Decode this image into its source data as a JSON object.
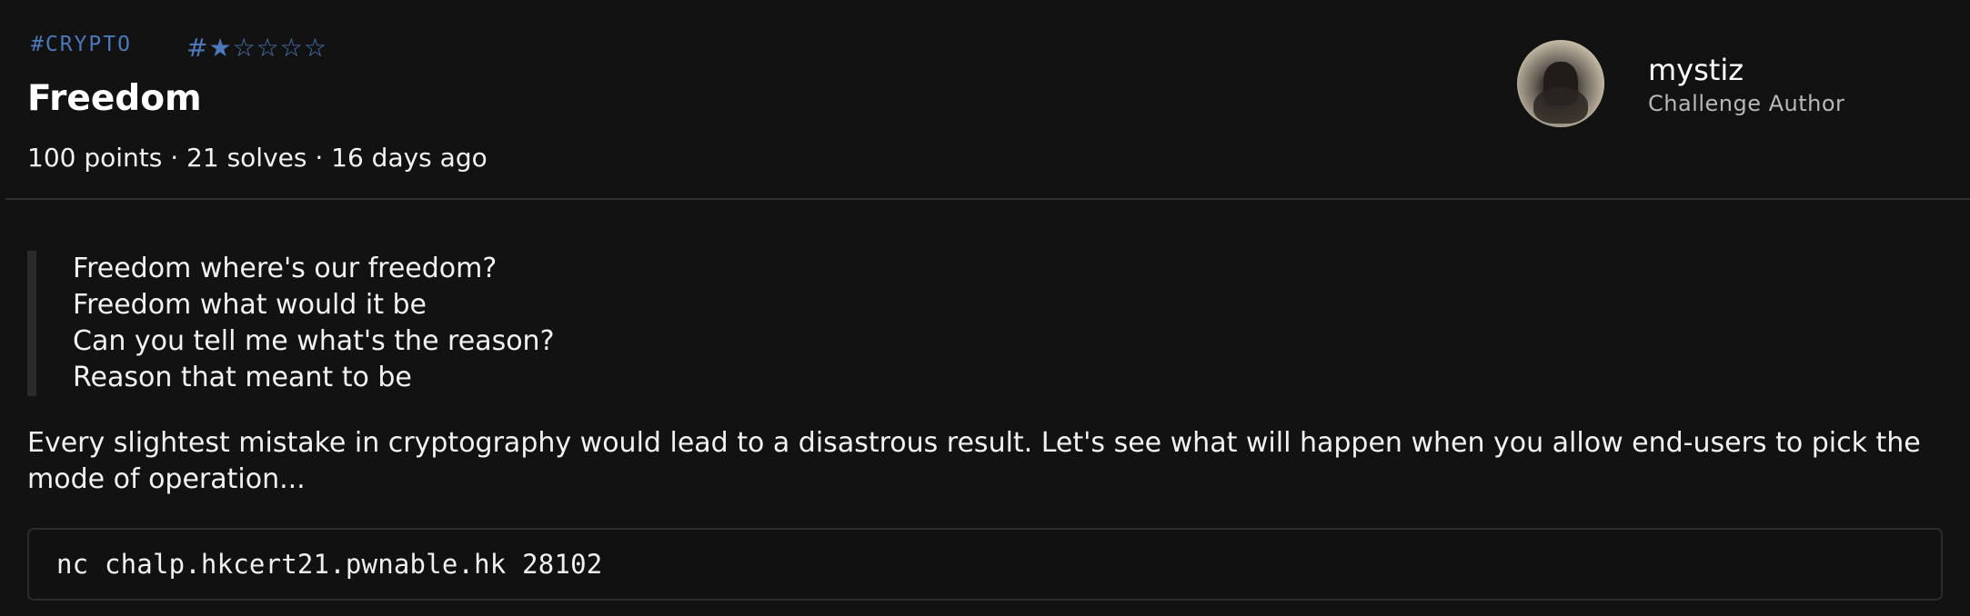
{
  "challenge": {
    "category_tag": "#CRYPTO",
    "difficulty": "#★☆☆☆☆",
    "title": "Freedom",
    "meta": "100 points · 21 solves · 16 days ago"
  },
  "author": {
    "name": "mystiz",
    "role": "Challenge Author"
  },
  "quote": {
    "lines": [
      "Freedom where's our freedom?",
      "Freedom what would it be",
      "Can you tell me what's the reason?",
      "Reason that meant to be"
    ]
  },
  "description": "Every slightest mistake in cryptography would lead to a disastrous result. Let's see what will happen when you allow end-users to pick the mode of operation...",
  "connection": {
    "command": "nc chalp.hkcert21.pwnable.hk 28102"
  },
  "colors": {
    "background": "#121212",
    "accent": "#4a78b8",
    "muted": "#b8b8b8"
  }
}
